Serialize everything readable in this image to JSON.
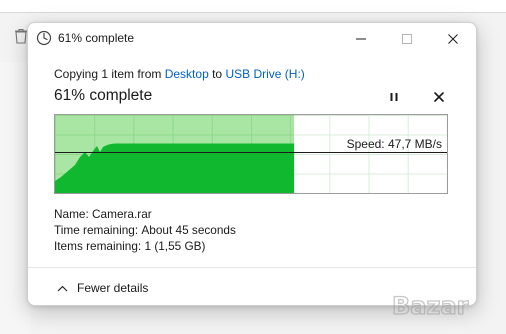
{
  "window": {
    "title": "61% complete"
  },
  "transfer": {
    "description_prefix": "Copying 1 item from ",
    "source": "Desktop",
    "connector": " to ",
    "destination": "USB Drive (H:)",
    "percent_label": "61% complete",
    "progress_fraction": 0.61,
    "speed_label": "Speed: 47,7 MB/s"
  },
  "details": {
    "name_label": "Name:",
    "name_value": "Camera.rar",
    "time_label": "Time remaining:",
    "time_value": "About 45 seconds",
    "items_label": "Items remaining:",
    "items_value": "1 (1,55 GB)"
  },
  "footer": {
    "toggle_label": "Fewer details"
  },
  "watermark": {
    "text": "Bazar"
  },
  "icons": {
    "app": "copy-progress-icon",
    "minimize": "minimize-icon",
    "maximize": "maximize-icon",
    "close": "close-icon",
    "pause": "pause-icon",
    "cancel": "close-icon",
    "toggle": "chevron-up-icon"
  },
  "colors": {
    "link": "#0061c2",
    "graph_fill": "#0fb82f",
    "graph_progress": "#a9e6a4"
  }
}
